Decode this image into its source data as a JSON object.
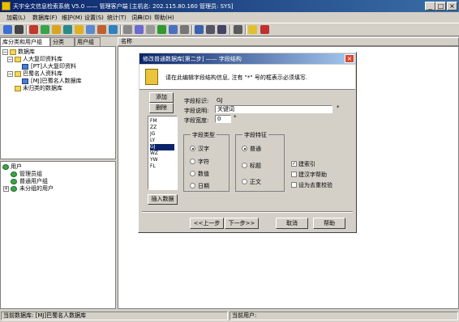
{
  "window": {
    "title": "天宇全文信息检索系统 V5.0 —— 管理客户端 [主机名: 202.115.80.160   管理员: SYS]",
    "min": "_",
    "max": "□",
    "close": "×"
  },
  "menu": [
    "加载(L)",
    "数据库(F)",
    "维护(M)",
    "设置(S)",
    "统计(T)",
    "词典(D)",
    "帮助(H)"
  ],
  "left_tabs": [
    "库分类和用户组",
    "分类",
    "用户组"
  ],
  "db_tree": {
    "root": "数据库",
    "items": [
      {
        "label": "人大复印资料库",
        "level": 1
      },
      {
        "label": "[PT]人大复印资料",
        "level": 2
      },
      {
        "label": "巴蜀名人资料库",
        "level": 1
      },
      {
        "label": "[MJ]巴蜀名人数据库",
        "level": 2
      },
      {
        "label": "未归类的数据库",
        "level": 1
      }
    ]
  },
  "user_tree": {
    "root": "用户",
    "items": [
      {
        "label": "管理员组"
      },
      {
        "label": "普通用户组"
      },
      {
        "label": "未分组的用户"
      }
    ]
  },
  "right_pane": {
    "column": "名称"
  },
  "status": {
    "current_db": "当前数据库: [MJ]巴蜀名人数据库",
    "current_user": "当前用户:"
  },
  "dialog": {
    "title": "修改普通数据库[第二步] —— 字段结构",
    "close": "×",
    "instruction": "请在此编辑字段结构信息, 注有 \"*\" 号的框表示必须填写.",
    "add_button": "添加",
    "delete_button": "删除",
    "insert_button": "插入数据",
    "fields": [
      "FM",
      "ZZ",
      "JG",
      "LY",
      "GJ",
      "WZ",
      "YW",
      "FL"
    ],
    "selected_field": "GJ",
    "field_id_label": "字段标识:",
    "field_id_value": "GJ",
    "field_desc_label": "字段说明:",
    "field_desc_value": "关键词",
    "field_width_label": "字段宽度:",
    "field_width_value": "0",
    "required_mark": "*",
    "type_group": {
      "title": "字段类型",
      "options": [
        "汉字",
        "字符",
        "数值",
        "日期"
      ],
      "selected": "汉字"
    },
    "feature_group": {
      "title": "字段特征",
      "options": [
        "普通",
        "标题",
        "正文"
      ],
      "selected": "普通"
    },
    "checkboxes": [
      {
        "label": "建索引",
        "checked": true
      },
      {
        "label": "建汉字帮助",
        "checked": false
      },
      {
        "label": "设为去重校验",
        "checked": false
      }
    ],
    "prev_button": "<<上一步",
    "next_button": "下一步>>",
    "cancel_button": "取消",
    "help_button": "帮助"
  },
  "colors": {
    "titlebar": "#0a246a",
    "face": "#d4d0c8",
    "selection": "#0a246a",
    "close_red": "#d9472b"
  }
}
